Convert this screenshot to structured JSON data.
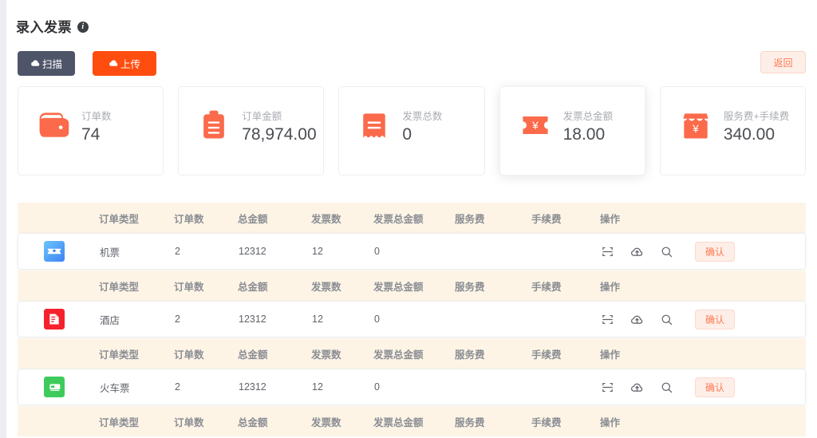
{
  "header": {
    "title": "录入发票",
    "info_icon": "info-icon"
  },
  "toolbar": {
    "scan_label": "扫描",
    "upload_label": "上传",
    "back_label": "返回"
  },
  "stats": [
    {
      "icon": "wallet-icon",
      "label": "订单数",
      "value": "74",
      "highlighted": false
    },
    {
      "icon": "clipboard-icon",
      "label": "订单金额",
      "value": "78,974.00",
      "highlighted": false
    },
    {
      "icon": "receipt-icon",
      "label": "发票总数",
      "value": "0",
      "highlighted": false
    },
    {
      "icon": "coupon-yen-icon",
      "label": "发票总金额",
      "value": "18.00",
      "highlighted": true
    },
    {
      "icon": "shop-yen-icon",
      "label": "服务费+手续费",
      "value": "340.00",
      "highlighted": false
    }
  ],
  "table": {
    "columns": [
      "订单类型",
      "订单数",
      "总金额",
      "发票数",
      "发票总金额",
      "服务费",
      "手续费",
      "操作"
    ],
    "actions": {
      "scan_icon": "scan-frame-icon",
      "upload_icon": "cloud-upload-icon",
      "search_icon": "search-icon",
      "confirm_label": "确认"
    },
    "rows": [
      {
        "icon": "flight-ticket-icon",
        "icon_color": "#4aa3f8",
        "type": "机票",
        "orders": "2",
        "amount": "12312",
        "invoices": "12",
        "invoice_amount": "0",
        "service_fee": "",
        "handling_fee": ""
      },
      {
        "icon": "hotel-icon",
        "icon_color": "#f5222d",
        "type": "酒店",
        "orders": "2",
        "amount": "12312",
        "invoices": "12",
        "invoice_amount": "0",
        "service_fee": "",
        "handling_fee": ""
      },
      {
        "icon": "train-ticket-icon",
        "icon_color": "#3ecb5c",
        "type": "火车票",
        "orders": "2",
        "amount": "12312",
        "invoices": "12",
        "invoice_amount": "0",
        "service_fee": "",
        "handling_fee": ""
      }
    ]
  },
  "colors": {
    "accent_orange": "#ff4d10",
    "icon_red": "#fa6a4e",
    "header_bg": "#fdf4e6",
    "dark_button": "#4e5569",
    "soft_button_bg": "#fdeee8",
    "soft_button_text": "#ff7a52"
  }
}
